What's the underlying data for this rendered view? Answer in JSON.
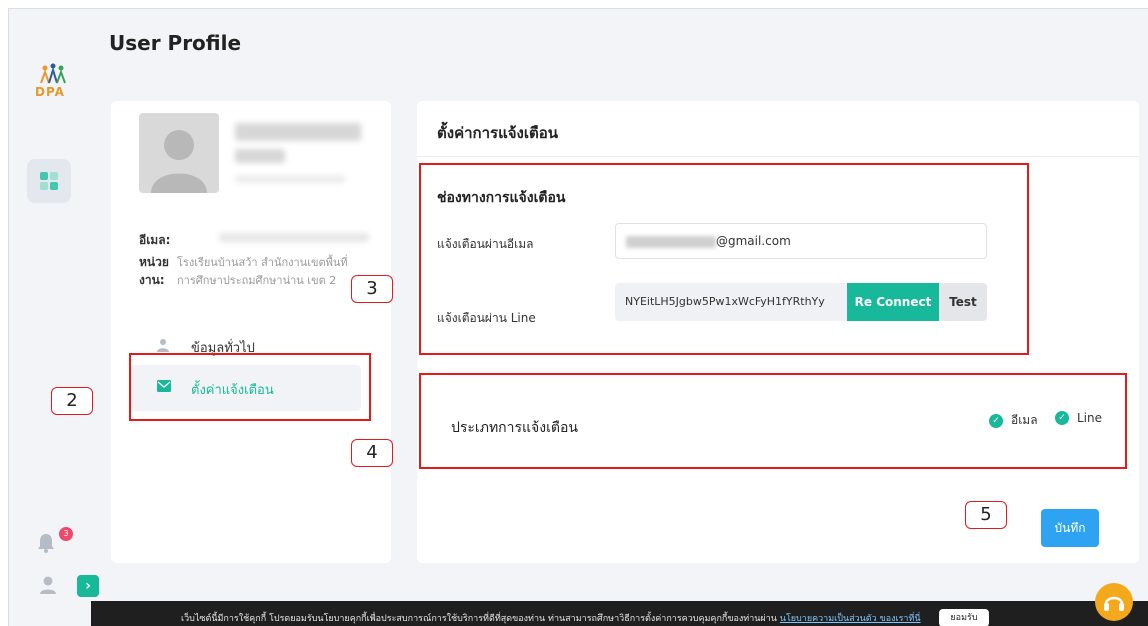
{
  "page": {
    "title": "User Profile"
  },
  "rail": {
    "logo_text": "DPA",
    "menu_icon": "grid-icon",
    "bell_badge": "3",
    "expand_icon": "chevron-right-icon"
  },
  "profile": {
    "email_label": "อีเมล:",
    "unit_label_line1": "หน่วย",
    "unit_label_line2": "งาน:",
    "unit_value_line1": "โรงเรียนบ้านสว้า สำนักงานเขตพื้นที่",
    "unit_value_line2": "การศึกษาประถมศึกษาน่าน เขต 2",
    "nav": [
      {
        "label": "ข้อมูลทั่วไป",
        "icon": "user-icon"
      },
      {
        "label": "ตั้งค่าแจ้งเตือน",
        "icon": "envelope-icon"
      }
    ]
  },
  "notifications": {
    "title": "ตั้งค่าการแจ้งเตือน",
    "channel_title": "ช่องทางการแจ้งเตือน",
    "email_label": "แจ้งเตือนผ่านอีเมล",
    "email_value": "@gmail.com",
    "line_label": "แจ้งเตือนผ่าน Line",
    "line_token": "NYEitLH5Jgbw5Pw1xWcFyH1fYRthYy",
    "reconnect_label": "Re Connect",
    "test_label": "Test",
    "type_title": "ประเภทการแจ้งเตือน",
    "type_options": [
      {
        "label": "อีเมล",
        "checked": true
      },
      {
        "label": "Line",
        "checked": true
      }
    ],
    "save_label": "บันทึก"
  },
  "callouts": {
    "c2": "2",
    "c3": "3",
    "c4": "4",
    "c5": "5"
  },
  "cookie": {
    "text": "เว็บไซต์นี้มีการใช้คุกกี้ โปรดยอมรับนโยบายคุกกี้เพื่อประสบการณ์การใช้บริการที่ดีที่สุดของท่าน ท่านสามารถศึกษาวิธีการตั้งค่าการควบคุมคุกกี้ของท่านผ่าน",
    "link": "นโยบายความเป็นส่วนตัว ของเราที่นี่",
    "accept": "ยอมรับ"
  },
  "colors": {
    "accent": "#18b99a",
    "primary": "#2ea3f2",
    "annotation": "#e21b1b"
  }
}
